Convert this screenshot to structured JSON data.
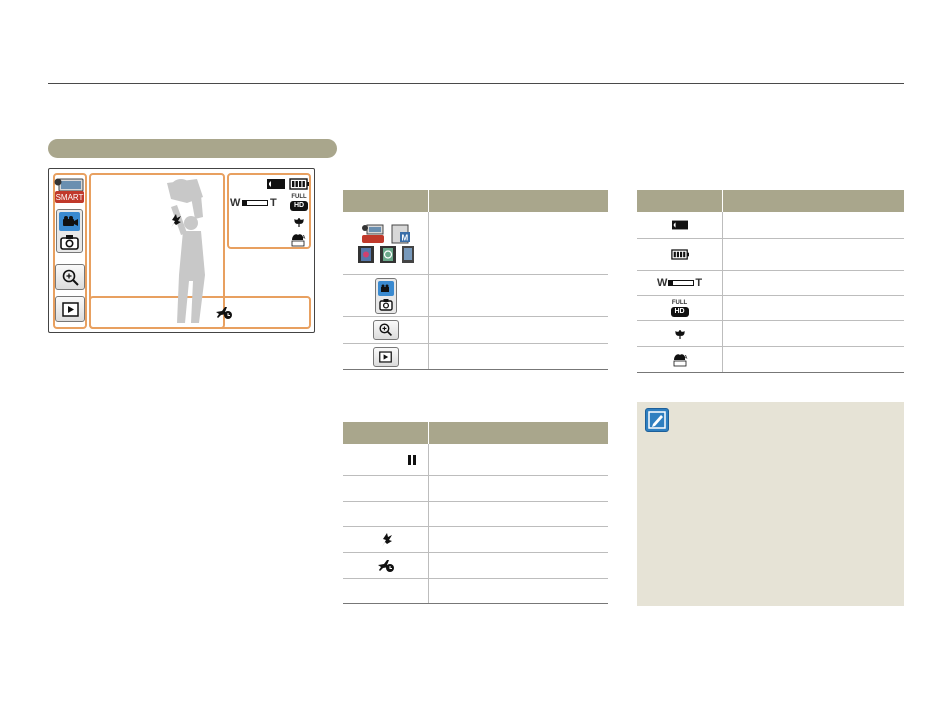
{
  "lcd_screen": {
    "smart_label": "SMART",
    "hd_badge_top": "FULL",
    "hd_badge_bottom": "HD",
    "zoom_w": "W",
    "zoom_t": "T",
    "icons": [
      "smart-auto-icon",
      "video-mode-icon",
      "photo-mode-icon",
      "zoom-icon",
      "playback-icon",
      "storage-card-icon",
      "battery-icon",
      "zoom-bar-icon",
      "full-hd-icon",
      "macro-icon",
      "wind-cut-icon",
      "antishake-icon",
      "time-lapse-icon"
    ]
  },
  "table_mode": {
    "rows": [
      {
        "icons": [
          "smart-auto-icon",
          "manual-mode-icon",
          "film-effect-icon",
          "time-lapse-mode-icon",
          "scene-icon"
        ]
      },
      {
        "icons": [
          "video-mode-icon",
          "photo-mode-icon"
        ]
      },
      {
        "icons": [
          "zoom-icon"
        ]
      },
      {
        "icons": [
          "playback-icon"
        ]
      }
    ]
  },
  "table_status": {
    "rows": [
      {
        "icons": [
          "pause-icon"
        ]
      },
      {
        "icons": []
      },
      {
        "icons": []
      },
      {
        "icons": [
          "antishake-icon"
        ]
      },
      {
        "icons": [
          "time-lapse-icon"
        ]
      },
      {
        "icons": []
      }
    ]
  },
  "table_right": {
    "rows": [
      {
        "icons": [
          "storage-card-icon"
        ]
      },
      {
        "icons": [
          "battery-icon"
        ]
      },
      {
        "icons": [
          "zoom-bar-icon"
        ],
        "zoom_w": "W",
        "zoom_t": "T"
      },
      {
        "icons": [
          "full-hd-icon"
        ],
        "hd_top": "FULL",
        "hd_bottom": "HD"
      },
      {
        "icons": [
          "macro-icon"
        ]
      },
      {
        "icons": [
          "wind-cut-icon"
        ]
      }
    ]
  },
  "note": {
    "icon": "note-icon"
  },
  "colors": {
    "header": "#a9a68c",
    "accent_orange": "#e8a060",
    "note_bg": "#e6e3d6",
    "icon_blue": "#2f7fc0"
  }
}
